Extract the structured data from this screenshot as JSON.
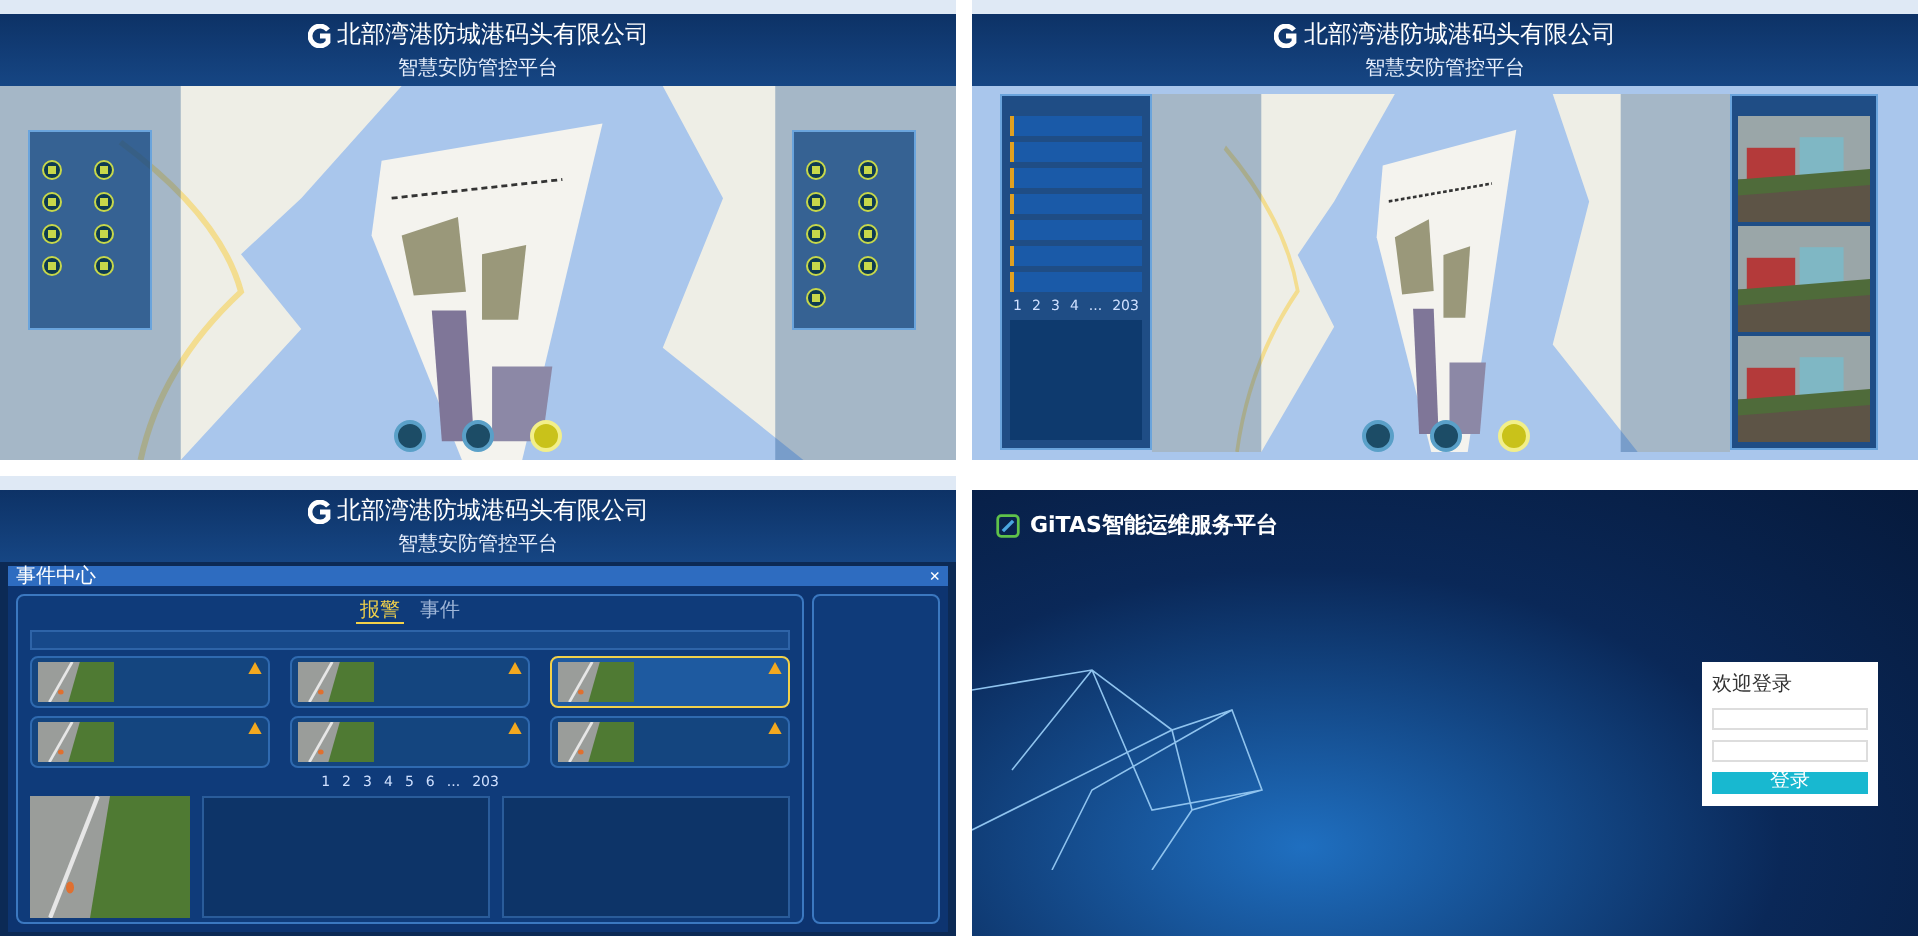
{
  "screens": [
    {
      "kind": "stats_map",
      "company": "北部湾港防城港码头有限公司",
      "platform": "智慧安防管控平台"
    },
    {
      "kind": "events_map",
      "company": "北部湾港防城港码头有限公司",
      "platform": "智慧安防管控平台",
      "pager": [
        "1",
        "2",
        "3",
        "4",
        "...",
        "203"
      ]
    },
    {
      "kind": "events",
      "company": "北部湾港防城港码头有限公司",
      "platform": "智慧安防管控平台",
      "dialog_title": "事件中心",
      "close": "×",
      "tabs": [
        {
          "label": "报警",
          "selected": true
        },
        {
          "label": "事件",
          "selected": false
        }
      ],
      "cards": [
        {
          "selected": false
        },
        {
          "selected": false
        },
        {
          "selected": true
        },
        {
          "selected": false
        },
        {
          "selected": false
        },
        {
          "selected": false
        }
      ],
      "pager": [
        "1",
        "2",
        "3",
        "4",
        "5",
        "6",
        "...",
        "203"
      ]
    },
    {
      "kind": "login",
      "brand": "GiTAS智能运维服务平台",
      "login_title": "欢迎登录",
      "login_button": "登录"
    }
  ]
}
